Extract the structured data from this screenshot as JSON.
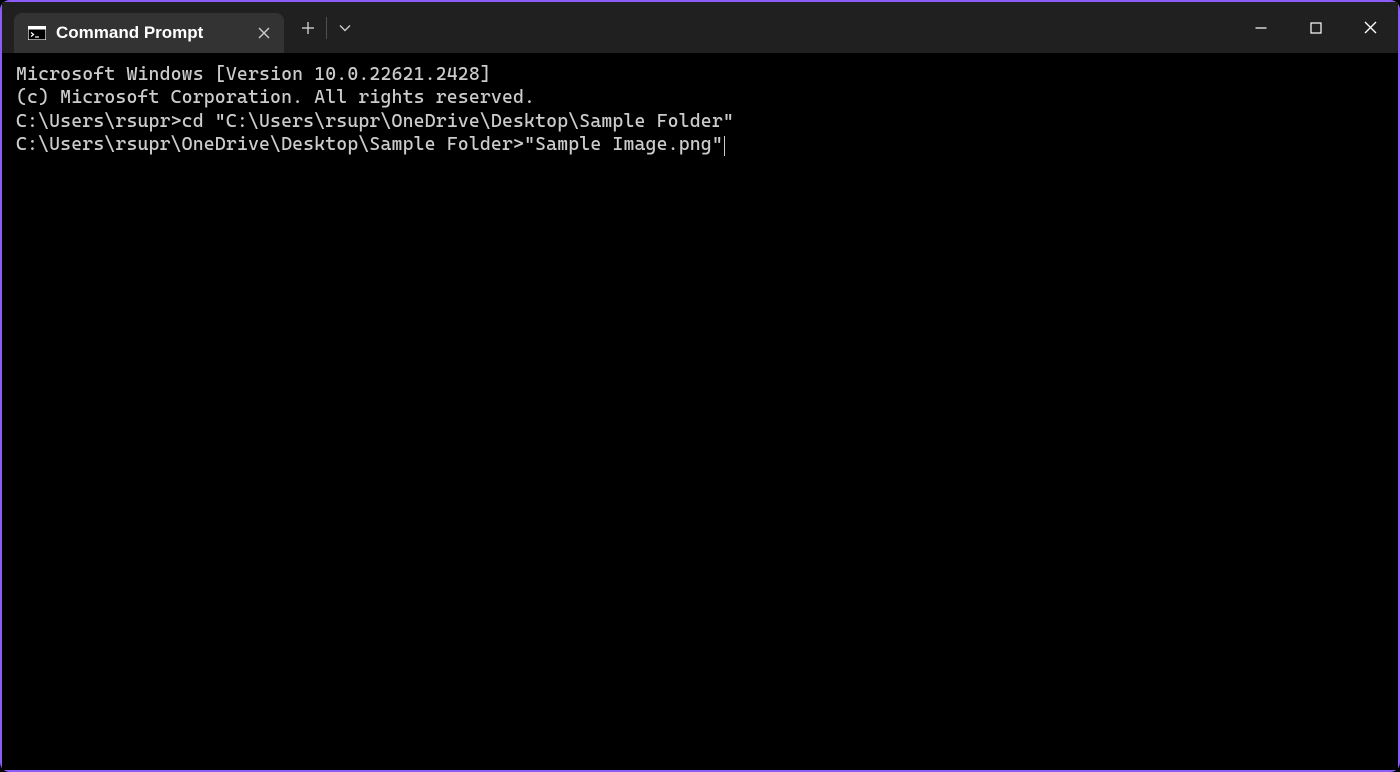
{
  "titlebar": {
    "tab": {
      "title": "Command Prompt"
    }
  },
  "terminal": {
    "line1": "Microsoft Windows [Version 10.0.22621.2428]",
    "line2": "(c) Microsoft Corporation. All rights reserved.",
    "line3": "",
    "line4_prompt": "C:\\Users\\rsupr>",
    "line4_cmd": "cd \"C:\\Users\\rsupr\\OneDrive\\Desktop\\Sample Folder\"",
    "line5": "",
    "line6_prompt": "C:\\Users\\rsupr\\OneDrive\\Desktop\\Sample Folder>",
    "line6_cmd": "\"Sample Image.png\""
  }
}
